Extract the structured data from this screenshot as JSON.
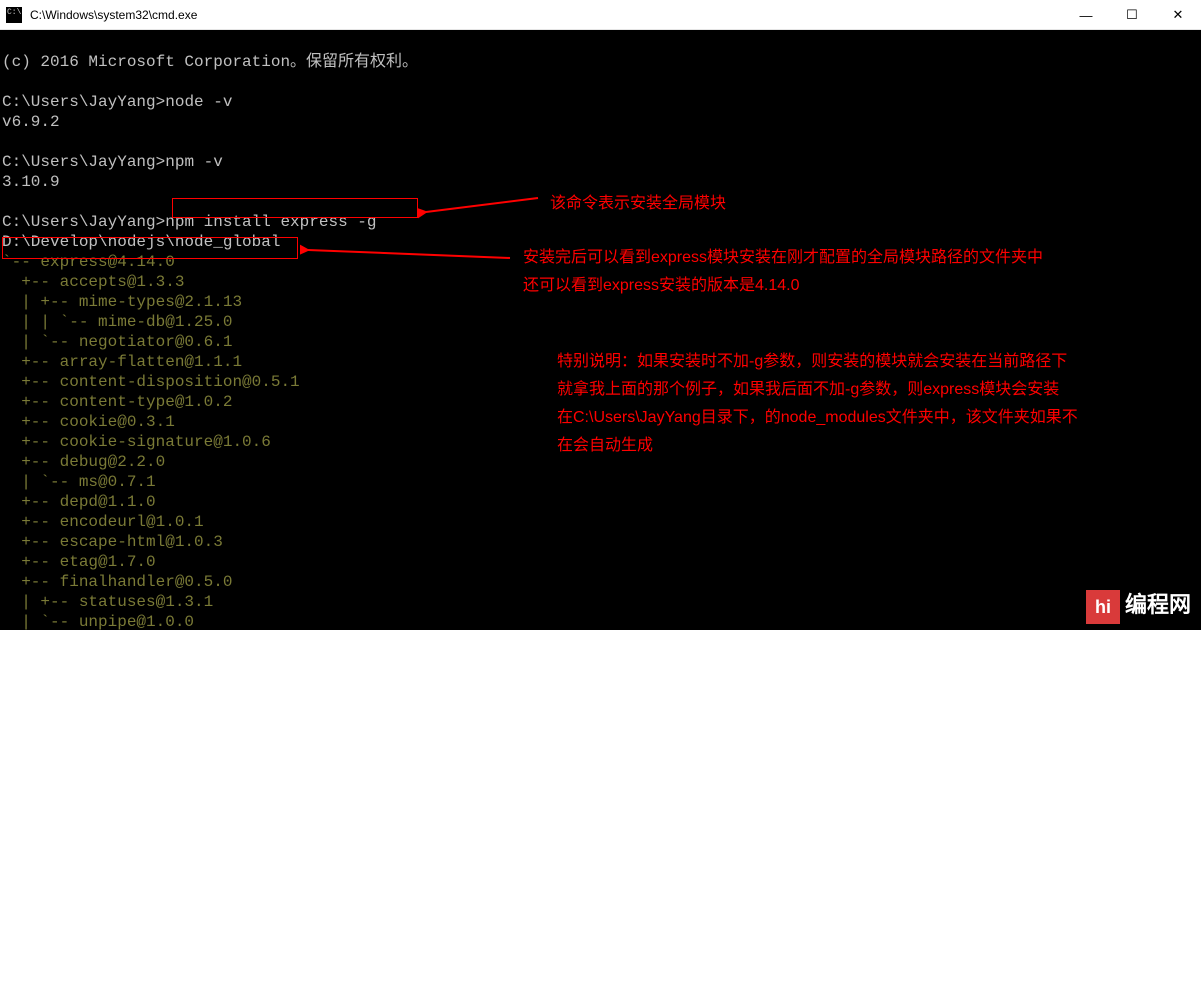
{
  "window": {
    "title": "C:\\Windows\\system32\\cmd.exe"
  },
  "terminal": {
    "copyright": "(c) 2016 Microsoft Corporation。保留所有权利。",
    "prompt1": "C:\\Users\\JayYang>",
    "cmd1": "node -v",
    "out1": "v6.9.2",
    "prompt2": "C:\\Users\\JayYang>",
    "cmd2": "npm -v",
    "out2": "3.10.9",
    "prompt3": "C:\\Users\\JayYang>",
    "cmd3": "npm install express -g",
    "path": "D:\\Develop\\nodejs\\node_global",
    "tree": [
      "`-- express@4.14.0",
      "  +-- accepts@1.3.3",
      "  | +-- mime-types@2.1.13",
      "  | | `-- mime-db@1.25.0",
      "  | `-- negotiator@0.6.1",
      "  +-- array-flatten@1.1.1",
      "  +-- content-disposition@0.5.1",
      "  +-- content-type@1.0.2",
      "  +-- cookie@0.3.1",
      "  +-- cookie-signature@1.0.6",
      "  +-- debug@2.2.0",
      "  | `-- ms@0.7.1",
      "  +-- depd@1.1.0",
      "  +-- encodeurl@1.0.1",
      "  +-- escape-html@1.0.3",
      "  +-- etag@1.7.0",
      "  +-- finalhandler@0.5.0",
      "  | +-- statuses@1.3.1",
      "  | `-- unpipe@1.0.0"
    ]
  },
  "annotations": {
    "a1": "该命令表示安装全局模块",
    "a2_l1": "安装完后可以看到express模块安装在刚才配置的全局模块路径的文件夹中",
    "a2_l2": "还可以看到express安装的版本是4.14.0",
    "a3_l1": "特别说明：如果安装时不加-g参数，则安装的模块就会安装在当前路径下",
    "a3_l2": "就拿我上面的那个例子，如果我后面不加-g参数，则express模块会安装",
    "a3_l3": "在C:\\Users\\JayYang目录下，的node_modules文件夹中，该文件夹如果不",
    "a3_l4": "在会自动生成"
  },
  "watermark": {
    "icon": "hi",
    "text": "编程网"
  }
}
